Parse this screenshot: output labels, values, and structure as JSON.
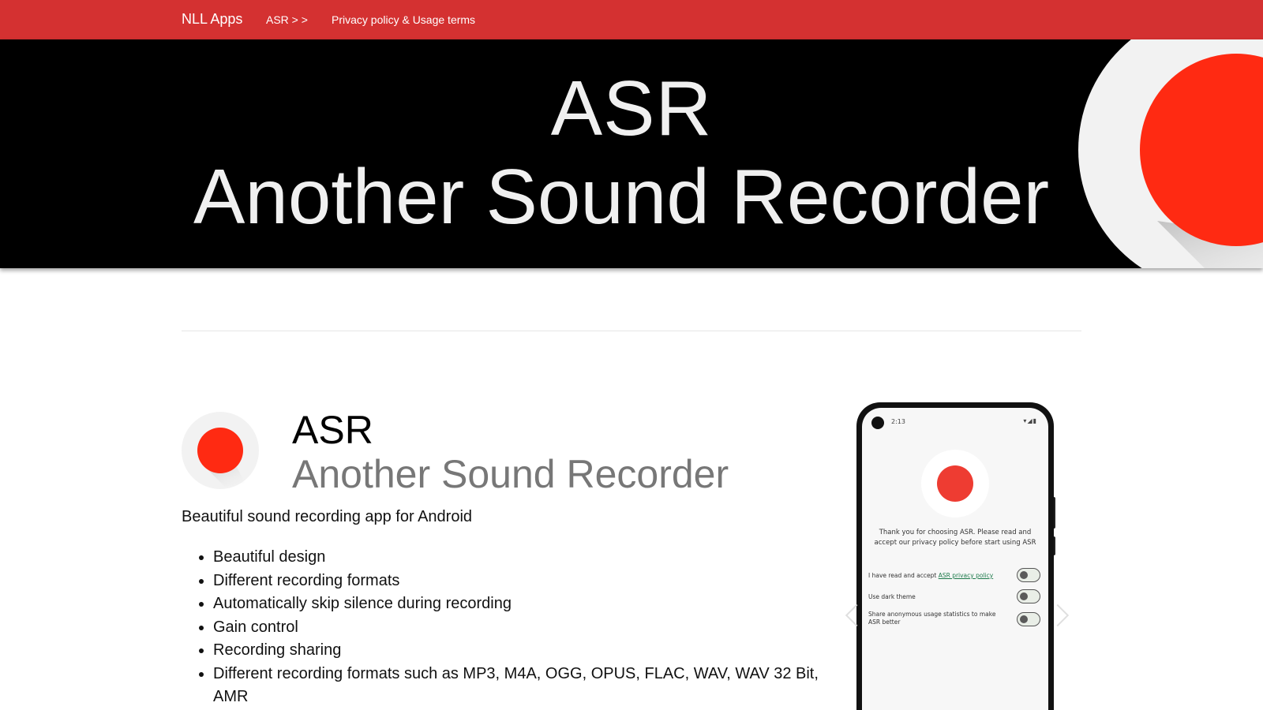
{
  "navbar": {
    "brand": "NLL Apps",
    "asr_link": "ASR > >",
    "privacy_link": "Privacy policy & Usage terms",
    "color": "#d43131"
  },
  "hero": {
    "title_line1": "ASR",
    "title_line2": "Another Sound Recorder",
    "logo_icon": "record-icon",
    "accent_color": "#ff2a12"
  },
  "app": {
    "name": "ASR",
    "full_name": "Another Sound Recorder",
    "tagline": "Beautiful sound recording app for Android",
    "features": [
      "Beautiful design",
      "Different recording formats",
      "Automatically skip silence during recording",
      "Gain control",
      "Recording sharing",
      "Different recording formats such as MP3, M4A, OGG, OPUS, FLAC, WAV, WAV 32 Bit, AMR"
    ]
  },
  "phone_screen": {
    "time": "2:13",
    "message": "Thank you for choosing ASR. Please read and accept our privacy policy before start using ASR",
    "settings": {
      "privacy_prefix": "I have read and accept ",
      "privacy_link": "ASR privacy policy",
      "dark_theme": "Use dark theme",
      "usage_stats": "Share anonymous usage statistics to make ASR better"
    }
  }
}
